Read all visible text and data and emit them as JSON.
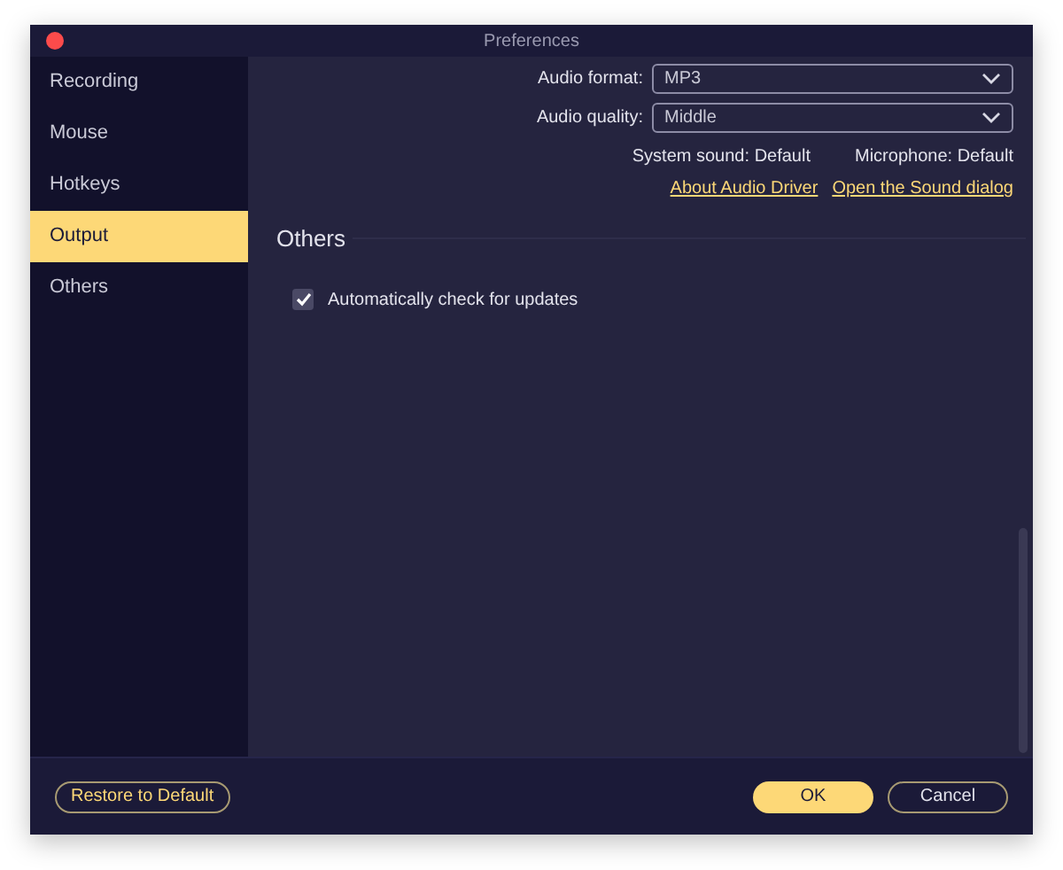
{
  "window": {
    "title": "Preferences"
  },
  "sidebar": {
    "items": [
      {
        "label": "Recording",
        "selected": false
      },
      {
        "label": "Mouse",
        "selected": false
      },
      {
        "label": "Hotkeys",
        "selected": false
      },
      {
        "label": "Output",
        "selected": true
      },
      {
        "label": "Others",
        "selected": false
      }
    ]
  },
  "output": {
    "fields": [
      {
        "label": "Audio format:",
        "value": "MP3"
      },
      {
        "label": "Audio quality:",
        "value": "Middle"
      }
    ],
    "system_sound": {
      "label": "System sound:",
      "value": "Default"
    },
    "microphone": {
      "label": "Microphone:",
      "value": "Default"
    },
    "links": [
      "About Audio Driver",
      "Open the Sound dialog"
    ]
  },
  "others": {
    "heading": "Others",
    "options": [
      {
        "label": "Automatically check for updates",
        "checked": true
      }
    ]
  },
  "footer": {
    "restore": "Restore to Default",
    "ok": "OK",
    "cancel": "Cancel"
  }
}
